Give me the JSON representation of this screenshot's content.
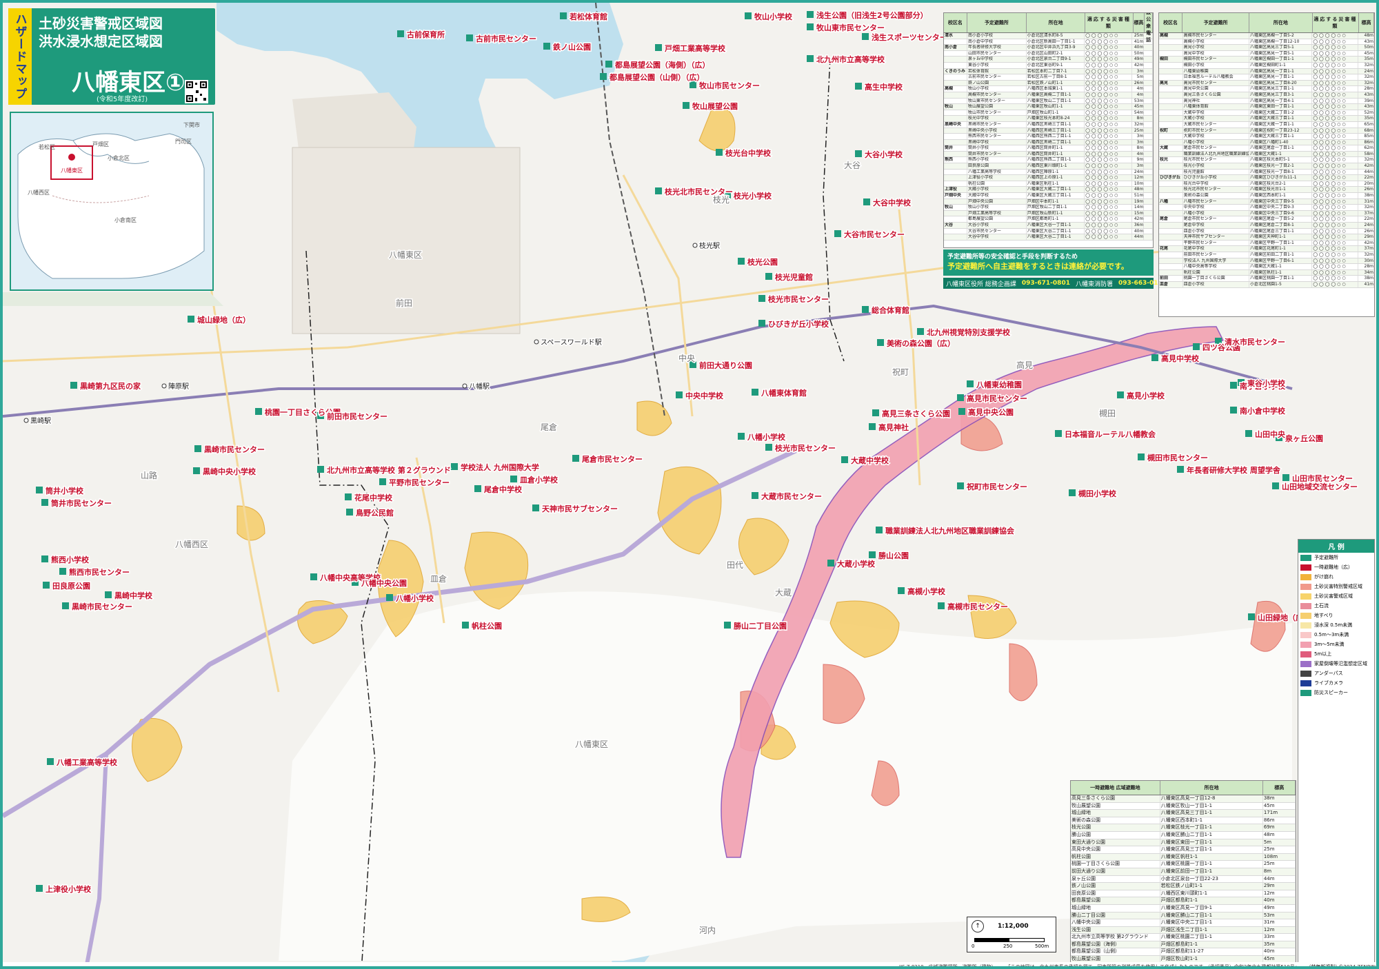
{
  "header": {
    "side_tab": "ハザードマップ",
    "title_line1": "土砂災害警戒区域図",
    "title_line2": "洪水浸水想定区域図",
    "area": "八幡東区①",
    "revision": "(令和5年度改訂)"
  },
  "inset": {
    "labels": [
      "若松区",
      "戸畑区",
      "門司区",
      "小倉北区",
      "八幡西区",
      "八幡東区",
      "小倉南区",
      "下関市"
    ]
  },
  "places": {
    "red": [
      "若松体育館",
      "鉄ノ山公園",
      "古前保育所",
      "古前市民センター",
      "牧山小学校",
      "浅生公園（旧浅生2号公園部分）",
      "牧山東市民センター",
      "浅生スポーツセンター",
      "都島展望公園（海側）（広）",
      "戸畑工業高等学校",
      "都島展望公園（山側）（広）",
      "北九州市立高等学校",
      "牧山市民センター",
      "高生中学校",
      "牧山展望公園",
      "枝光台中学校",
      "大谷小学校",
      "枝光北市民センター",
      "枝光小学校",
      "大谷中学校",
      "大谷市民センター",
      "枝光公園",
      "枝光児童館",
      "枝光市民センター",
      "ひびきが丘小学校",
      "美術の森公園（広）",
      "北九州視覚特別支援学校",
      "総合体育館",
      "城山緑地（広）",
      "黒崎第九区民の家",
      "前田大通り公園",
      "中央中学校",
      "八幡東体育館",
      "高見市民センター",
      "高見中学校",
      "高見小学校",
      "八幡東幼稚園",
      "四ツ谷公園",
      "清水市民センター",
      "桃園一丁目さくら公園",
      "前田市民センター",
      "尾倉市民センター",
      "学校法人 九州国際大学",
      "八幡小学校",
      "高見中央公園",
      "高見三条さくら公園",
      "高見神社",
      "大蔵中学校",
      "枝光市民センター",
      "日本福音ルーテル八幡教会",
      "黒崎市民センター",
      "黒崎中央小学校",
      "北九州市立高等学校 第２グラウンド",
      "槻田市民センター",
      "平野市民センター",
      "皿倉小学校",
      "尾倉中学校",
      "大蔵市民センター",
      "祝町市民センター",
      "槻田小学校",
      "花尾中学校",
      "鳥野公民館",
      "天神市民サブセンター",
      "職業訓練法人北九州地区職業訓練協会",
      "勝山公園",
      "大蔵小学校",
      "八幡中央高等学校",
      "高槻小学校",
      "高槻市民センター",
      "山田緑地（広）",
      "帆柱公園",
      "勝山二丁目公園",
      "山田中央",
      "熊西小学校",
      "熊西市民センター",
      "田良原公園",
      "黒崎中学校",
      "黒崎市民センター",
      "筒井小学校",
      "筒井市民センター",
      "八幡工業高等学校",
      "上津役小学校",
      "南小倉小学校",
      "南小倉中学校",
      "泉ヶ丘公園",
      "年長者研修大学校 周望学舎",
      "山田市民センター",
      "山田地域交流センター",
      "東谷小学校",
      "八幡中央公園",
      "八幡小学校"
    ],
    "area": [
      "八幡東区",
      "八幡東区",
      "八幡西区",
      "大蔵",
      "枝光",
      "中央",
      "尾倉",
      "皿倉",
      "田代",
      "大谷",
      "前田",
      "祝町",
      "槻田",
      "高見",
      "山路",
      "河内"
    ],
    "stations": [
      "八幡駅",
      "枝光駅",
      "スペースワールド駅",
      "黒崎駅",
      "陣原駅"
    ]
  },
  "table_left": {
    "headers": [
      "校区名",
      "予定避難所",
      "所在地",
      "適応する災害種類",
      "標高",
      "特設公衆電話"
    ],
    "rows": [
      [
        "清水",
        "南小倉小学校",
        "小倉北区清水町8-5",
        "◯◯◯◯○○",
        "25m",
        ""
      ],
      [
        "",
        "南小倉中学校",
        "小倉北区新高田一丁目1-1",
        "◯◯◯◯○○",
        "41m",
        ""
      ],
      [
        "南小倉",
        "年長者研修大学校",
        "小倉北区中井浜九丁目3-9",
        "◯◯◯◯○○",
        "40m",
        ""
      ],
      [
        "",
        "山田市民センター",
        "小倉北区山田町2-1",
        "◯◯◯◯○○",
        "50m",
        ""
      ],
      [
        "",
        "泉ヶ丘中学校",
        "小倉北区泉台二丁目9-1",
        "◯◯◯◯○○",
        "49m",
        ""
      ],
      [
        "",
        "東谷小学校",
        "小倉北区東谷町9-1",
        "◯◯◯◯○○",
        "42m",
        ""
      ],
      [
        "くきのうみ",
        "若松体育館",
        "若松区本町二丁目7-1",
        "◯◯◯◯○○",
        "3m",
        ""
      ],
      [
        "",
        "古前市民センター",
        "若松区古前一丁目8-1",
        "◯◯◯◯○○",
        "5m",
        ""
      ],
      [
        "",
        "鉄ノ山公園",
        "若松区鉄ノ山町1-1",
        "◯◯◯◯○○",
        "26m",
        ""
      ],
      [
        "高槻",
        "牧山小学校",
        "八幡西区本城東1-1",
        "◯◯◯◯○○",
        "4m",
        ""
      ],
      [
        "",
        "高槻市民センター",
        "八幡東区高槻二丁目1-1",
        "◯◯◯◯○○",
        "4m",
        ""
      ],
      [
        "",
        "牧山東市民センター",
        "八幡東区牧山二丁目1-1",
        "◯◯◯◯○○",
        "53m",
        ""
      ],
      [
        "牧山",
        "牧山展望公園",
        "八幡東区牧山町1-1",
        "◯◯◯◯○○",
        "45m",
        ""
      ],
      [
        "",
        "牧山市民センター",
        "戸畑区牧山町1-1",
        "◯◯◯◯○○",
        "54m",
        ""
      ],
      [
        "",
        "枝光中学校",
        "八幡東区枝光本町8-24",
        "◯◯◯◯○○",
        "8m",
        ""
      ],
      [
        "黒崎中央",
        "黒崎市民センター",
        "八幡西区黒崎三丁目1-1",
        "◯◯◯◯○○",
        "32m",
        ""
      ],
      [
        "",
        "黒崎中央小学校",
        "八幡西区黒崎三丁目1-1",
        "◯◯◯◯○○",
        "25m",
        ""
      ],
      [
        "",
        "熊西市民センター",
        "八幡西区熊西二丁目1-1",
        "◯◯◯◯○○",
        "3m",
        ""
      ],
      [
        "",
        "黒崎中学校",
        "八幡西区黒崎二丁目1-1",
        "◯◯◯◯○○",
        "3m",
        ""
      ],
      [
        "筒井",
        "筒井小学校",
        "八幡西区筒井町1-1",
        "◯◯◯◯○○",
        "8m",
        ""
      ],
      [
        "",
        "筒井市民センター",
        "八幡西区筒井町1-1",
        "◯◯◯◯○○",
        "4m",
        ""
      ],
      [
        "熊西",
        "熊西小学校",
        "八幡西区熊西二丁目1-1",
        "◯◯◯◯○○",
        "9m",
        ""
      ],
      [
        "",
        "田良原公園",
        "八幡西区東川頭町1-1",
        "◯◯◯◯○○",
        "3m",
        ""
      ],
      [
        "",
        "八幡工業高等学校",
        "八幡西区陣原1-1",
        "◯◯◯◯○○",
        "24m",
        ""
      ],
      [
        "",
        "上津役小学校",
        "八幡西区上の原1-1",
        "◯◯◯◯○○",
        "12m",
        ""
      ],
      [
        "",
        "帆柱公園",
        "八幡東区帆柱1-1",
        "◯◯◯◯○○",
        "10m",
        ""
      ],
      [
        "上津役",
        "大蔵小学校",
        "八幡東区大蔵二丁目1-1",
        "◯◯◯◯○○",
        "48m",
        ""
      ],
      [
        "戸畑中央",
        "大蔵中学校",
        "八幡東区大蔵三丁目1-1",
        "◯◯◯◯○○",
        "51m",
        ""
      ],
      [
        "",
        "戸畑中央公園",
        "戸畑区中本町1-1",
        "◯◯◯◯○○",
        "19m",
        ""
      ],
      [
        "牧山",
        "牧山小学校",
        "戸畑区牧山二丁目1-1",
        "◯◯◯◯○○",
        "14m",
        ""
      ],
      [
        "",
        "戸畑工業高等学校",
        "戸畑区牧山新町1-1",
        "◯◯◯◯○○",
        "15m",
        ""
      ],
      [
        "",
        "都島展望公園",
        "戸畑区都島町1-1",
        "◯◯◯◯○○",
        "42m",
        ""
      ],
      [
        "大谷",
        "大谷小学校",
        "八幡東区大谷一丁目1-1",
        "◯◯◯◯○○",
        "36m",
        ""
      ],
      [
        "",
        "大谷市民センター",
        "八幡東区大谷二丁目1-1",
        "◯◯◯◯○○",
        "40m",
        ""
      ],
      [
        "",
        "大谷中学校",
        "八幡東区大谷二丁目1-1",
        "◯◯◯◯○○",
        "44m",
        ""
      ]
    ]
  },
  "table_right": {
    "headers": [
      "校区名",
      "予定避難所",
      "所在地",
      "適応する災害種類",
      "標高"
    ],
    "rows": [
      [
        "高槻",
        "高槻市民センター",
        "八幡東区高槻一丁目5-2",
        "◯◯◯◯○○",
        "48m"
      ],
      [
        "",
        "高槻小学校",
        "八幡東区高槻一丁目12-10",
        "◯◯◯◯○○",
        "43m"
      ],
      [
        "",
        "高見小学校",
        "八幡東区高見三丁目5-1",
        "◯◯◯◯○○",
        "50m"
      ],
      [
        "",
        "高見中学校",
        "八幡東区高見一丁目5-1",
        "◯◯◯◯○○",
        "45m"
      ],
      [
        "槻田",
        "槻田市民センター",
        "八幡東区槻田一丁目1-1",
        "◯◯◯◯○○",
        "35m"
      ],
      [
        "",
        "槻田小学校",
        "八幡東区槻田町1-1",
        "◯◯◯◯○○",
        "32m"
      ],
      [
        "",
        "八幡東幼稚園",
        "八幡東区高見一丁目1-1",
        "◯◯◯◯○○",
        "24m"
      ],
      [
        "",
        "日本福音ルーテル八幡教会",
        "八幡東区高見一丁目1-1",
        "◯◯◯◯○○",
        "32m"
      ],
      [
        "高見",
        "高見市民センター",
        "八幡東区高見二丁目8-20",
        "◯◯◯◯○○",
        "32m"
      ],
      [
        "",
        "高見中央公園",
        "八幡東区高見三丁目1-1",
        "◯◯◯◯○○",
        "28m"
      ],
      [
        "",
        "高見三条さくら公園",
        "八幡東区高見三丁目3-1",
        "◯◯◯◯○○",
        "43m"
      ],
      [
        "",
        "高見神社",
        "八幡東区高見一丁目4-1",
        "◯◯◯◯○○",
        "39m"
      ],
      [
        "",
        "八幡東体育館",
        "八幡東区東田一丁目1-1",
        "◯◯◯◯○○",
        "43m"
      ],
      [
        "",
        "大蔵中学校",
        "八幡東区大蔵二丁目1-2",
        "◯◯◯◯○○",
        "52m"
      ],
      [
        "",
        "大蔵小学校",
        "八幡東区大蔵三丁目1-1",
        "◯◯◯◯○○",
        "35m"
      ],
      [
        "",
        "大蔵市民センター",
        "八幡東区大蔵一丁目1-1",
        "◯◯◯◯○○",
        "65m"
      ],
      [
        "祝町",
        "祝町市民センター",
        "八幡東区祝町一丁目23-12",
        "◯◯◯◯○○",
        "68m"
      ],
      [
        "",
        "大蔵中学校",
        "八幡東区大蔵三丁目1-1",
        "◯◯◯◯○○",
        "85m"
      ],
      [
        "",
        "八幡小学校",
        "八幡東区八幡町1-40",
        "◯◯◯◯○○",
        "86m"
      ],
      [
        "大蔵",
        "尾倉市民センター",
        "八幡東区尾倉一丁目1-1",
        "◯◯◯◯○○",
        "62m"
      ],
      [
        "",
        "職業訓練法人北九州地区職業訓練協会",
        "八幡東区大蔵1-1",
        "◯◯◯◯○○",
        "58m"
      ],
      [
        "枝光",
        "枝光市民センター",
        "八幡東区枝光本町5-1",
        "◯◯◯◯○○",
        "32m"
      ],
      [
        "",
        "枝光小学校",
        "八幡東区枝光一丁目2-1",
        "◯◯◯◯○○",
        "42m"
      ],
      [
        "",
        "枝光児童館",
        "八幡東区枝光一丁目8-1",
        "◯◯◯◯○○",
        "44m"
      ],
      [
        "ひびきが丘",
        "ひびきが丘小学校",
        "八幡東区ひびきが丘11-1",
        "◯◯◯◯○○",
        "22m"
      ],
      [
        "",
        "枝光台中学校",
        "八幡東区枝光台2-1",
        "◯◯◯◯○○",
        "20m"
      ],
      [
        "",
        "枝光北市民センター",
        "八幡東区枝光台1-1",
        "◯◯◯◯○○",
        "26m"
      ],
      [
        "",
        "美術の森公園",
        "八幡東区西本町1-1",
        "◯◯◯◯○○",
        "38m"
      ],
      [
        "八幡",
        "八幡市民センター",
        "八幡東区中央三丁目9-5",
        "◯◯◯◯○○",
        "31m"
      ],
      [
        "",
        "中央中学校",
        "八幡東区中央二丁目9-3",
        "◯◯◯◯○○",
        "32m"
      ],
      [
        "",
        "八幡小学校",
        "八幡東区中央三丁目9-6",
        "◯◯◯◯○○",
        "37m"
      ],
      [
        "尾倉",
        "尾倉市民センター",
        "八幡東区尾倉一丁目5-2",
        "◯◯◯◯○○",
        "22m"
      ],
      [
        "",
        "尾倉中学校",
        "八幡東区尾倉二丁目8-1",
        "◯◯◯◯○○",
        "24m"
      ],
      [
        "",
        "皿倉小学校",
        "八幡東区尾倉三丁目1-1",
        "◯◯◯◯○○",
        "26m"
      ],
      [
        "",
        "天神市民サブセンター",
        "八幡東区天神町1-1",
        "◯◯◯◯○○",
        "29m"
      ],
      [
        "",
        "平野市民センター",
        "八幡東区平野一丁目1-1",
        "◯◯◯◯○○",
        "42m"
      ],
      [
        "花尾",
        "花尾中学校",
        "八幡東区花尾町1-1",
        "◯◯◯◯○○",
        "37m"
      ],
      [
        "",
        "前田市民センター",
        "八幡東区前田二丁目1-1",
        "◯◯◯◯○○",
        "32m"
      ],
      [
        "",
        "学校法人 九州国際大学",
        "八幡東区平野一丁目6-1",
        "◯◯◯◯○○",
        "30m"
      ],
      [
        "",
        "八幡中央高等学校",
        "八幡東区大蔵1-1",
        "◯◯◯◯○○",
        "28m"
      ],
      [
        "",
        "帆柱公園",
        "八幡東区帆柱1-1",
        "◯◯◯◯○○",
        "34m"
      ],
      [
        "前田",
        "桃園一丁目さくら公園",
        "八幡東区桃園一丁目1-1",
        "◯◯◯◯○○",
        "38m"
      ],
      [
        "皿倉",
        "皿倉小学校",
        "小倉北区桃園1-5",
        "◯◯◯◯○○",
        "41m"
      ]
    ]
  },
  "notice": {
    "line1": "予定避難所等の安全確認と手段を判断するため",
    "line2": "予定避難所へ自主避難をするときは連絡が必要です。",
    "contact_office": "八幡東区役所 総務企画課",
    "contact_office_tel": "093-671-0801",
    "contact_fire": "八幡東消防署",
    "contact_fire_tel": "093-663-0119"
  },
  "legend": {
    "title": "凡 例",
    "items": [
      {
        "label": "予定避難所",
        "color": "#1e9a7c"
      },
      {
        "label": "一時避難地（広）",
        "color": "#c8102e"
      },
      {
        "label": "がけ崩れ",
        "color": "#f2b23a"
      },
      {
        "label": "土砂災害特別警戒区域",
        "color": "#f19a8b"
      },
      {
        "label": "土砂災害警戒区域",
        "color": "#f7d36b"
      },
      {
        "label": "土石流",
        "color": "#e98d9a"
      },
      {
        "label": "地すべり",
        "color": "#f6cf6f"
      },
      {
        "label": "浸水深 0.5m未満",
        "color": "#f7e7a6"
      },
      {
        "label": "0.5m〜3m未満",
        "color": "#f9c8c8"
      },
      {
        "label": "3m〜5m未満",
        "color": "#f2a0b0"
      },
      {
        "label": "5m以上",
        "color": "#e05c7c"
      },
      {
        "label": "家屋倒壊等氾濫想定区域",
        "color": "#9b6fc7"
      },
      {
        "label": "アンダーパス",
        "color": "#444"
      },
      {
        "label": "ライブカメラ",
        "color": "#1e3c96"
      },
      {
        "label": "防災スピーカー",
        "color": "#1e9a7c"
      }
    ]
  },
  "sub_table": {
    "title1": "一時避難地",
    "title2": "広域避難地",
    "headers": [
      "一時避難地 広域避難地",
      "所在地",
      "標高"
    ],
    "rows": [
      [
        "高見三条さくら公園",
        "八幡東区高見一丁目12-8",
        "38m"
      ],
      [
        "牧山展望公園",
        "八幡東区牧山一丁目1-1",
        "45m"
      ],
      [
        "城山緑地",
        "八幡東区高見三丁目1-1",
        "171m"
      ],
      [
        "美術の森公園",
        "八幡東区西本町1-1",
        "86m"
      ],
      [
        "枝光公園",
        "八幡東区枝光一丁目1-1",
        "69m"
      ],
      [
        "勝山公園",
        "八幡東区勝山二丁目1-1",
        "48m"
      ],
      [
        "東田大通り公園",
        "八幡東区東田一丁目1-1",
        "5m"
      ],
      [
        "高見中央公園",
        "八幡東区高見三丁目1-1",
        "25m"
      ],
      [
        "帆柱公園",
        "八幡東区帆柱1-1",
        "108m"
      ],
      [
        "桃園一丁目さくら公園",
        "八幡東区桃園一丁目1-1",
        "25m"
      ],
      [
        "前田大通り公園",
        "八幡東区前田一丁目1-1",
        "8m"
      ],
      [
        "泉ヶ丘公園",
        "小倉北区泉台一丁目22-23",
        "44m"
      ],
      [
        "鉄ノ山公園",
        "若松区鉄ノ山町1-1",
        "29m"
      ],
      [
        "田良原公園",
        "八幡西区東川頭町1-1",
        "12m"
      ],
      [
        "都島展望公園",
        "戸畑区都島町1-1",
        "40m"
      ],
      [
        "城山緑地",
        "八幡東区高見一丁目9-1",
        "49m"
      ],
      [
        "勝山二丁目公園",
        "八幡東区勝山二丁目1-1",
        "53m"
      ],
      [
        "八幡中央公園",
        "八幡東区中央二丁目1-1",
        "31m"
      ],
      [
        "浅生公園",
        "戸畑区浅生二丁目1-1",
        "12m"
      ],
      [
        "北九州市立高等学校 第2グラウンド",
        "八幡東区桃園二丁目1-1",
        "33m"
      ],
      [
        "都島展望公園（海側）",
        "戸畑区都島町1-1",
        "35m"
      ],
      [
        "都島展望公園（山側）",
        "戸畑区都島町11-27",
        "40m"
      ],
      [
        "牧山展望公園",
        "戸畑区牧山町1-1",
        "45m"
      ],
      [
        "山田緑地",
        "小倉北区山田町1-1",
        "106m"
      ]
    ]
  },
  "scale": {
    "ratio": "1:12,000",
    "ticks": [
      "0",
      "250",
      "500m"
    ]
  },
  "footer": {
    "jis": "JIS Z 8210　広域避難場所　避難所（建物）",
    "note": "「この地図は、北九州市長の承認を得て、同市所管の測量成果を使用して作成したものです。（承認番号）令和2年北九建都計第510号」",
    "copyright": "(禁無断複製) ©2024 ZENRIN CO., LTD."
  }
}
